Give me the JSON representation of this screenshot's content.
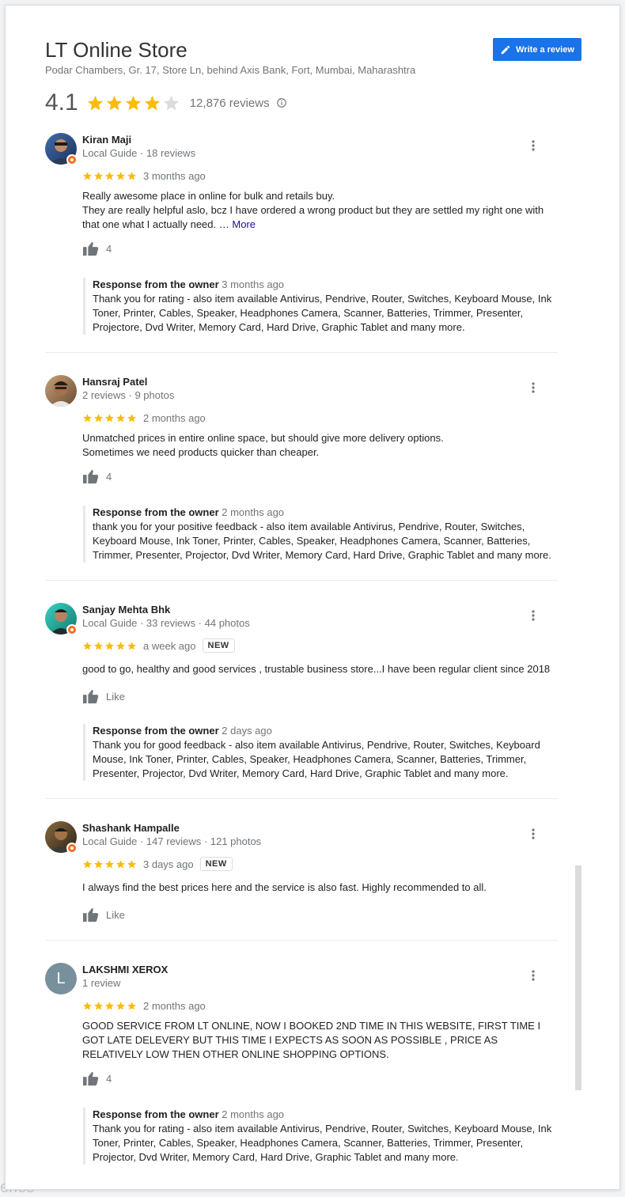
{
  "header": {
    "title": "LT Online Store",
    "address": "Podar Chambers, Gr. 17, Store Ln, behind Axis Bank, Fort, Mumbai, Maharashtra",
    "write_review_label": "Write a review",
    "rating": "4.1",
    "rating_value": 4.1,
    "review_count": "12,876 reviews"
  },
  "colors": {
    "accent": "#1a73e8",
    "star": "#fbbc04",
    "guide_badge": "#f16e23",
    "avatar_initial_bg": "#78909c"
  },
  "reviews": [
    {
      "name": "Kiran Maji",
      "meta": "Local Guide · 18 reviews",
      "stars": 5,
      "time": "3 months ago",
      "new_badge": "",
      "text": "Really awesome place in online for bulk and retails buy.\nThey are really helpful aslo, bcz I have ordered a wrong product but they are settled my right one with that one what I actually need. …",
      "more_label": "More",
      "likes": "4",
      "owner_label": "Response from the owner",
      "owner_time": "3 months ago",
      "owner_text": "Thank you for rating - also item available Antivirus, Pendrive, Router, Switches, Keyboard Mouse, Ink Toner, Printer, Cables, Speaker, Headphones Camera, Scanner, Batteries, Trimmer, Presenter, Projectore, Dvd Writer, Memory Card, Hard Drive, Graphic Tablet and many more."
    },
    {
      "name": "Hansraj Patel",
      "meta": "2 reviews · 9 photos",
      "stars": 5,
      "time": "2 months ago",
      "new_badge": "",
      "text": "Unmatched prices in entire online space, but should give more delivery options.\nSometimes we need products quicker than cheaper.",
      "likes": "4",
      "owner_label": "Response from the owner",
      "owner_time": "2 months ago",
      "owner_text": "thank you for your positive feedback - also item available Antivirus, Pendrive, Router, Switches, Keyboard Mouse, Ink Toner, Printer, Cables, Speaker, Headphones Camera, Scanner, Batteries, Trimmer, Presenter, Projector, Dvd Writer, Memory Card, Hard Drive, Graphic Tablet and many more."
    },
    {
      "name": "Sanjay Mehta Bhk",
      "meta": "Local Guide · 33 reviews · 44 photos",
      "stars": 5,
      "time": "a week ago",
      "new_badge": "NEW",
      "text": "good to go, healthy and good services , trustable business store...I have been regular client since 2018",
      "likes": "Like",
      "owner_label": "Response from the owner",
      "owner_time": "2 days ago",
      "owner_text": "Thank you for good feedback - also item available Antivirus, Pendrive, Router, Switches, Keyboard Mouse, Ink Toner, Printer, Cables, Speaker, Headphones Camera, Scanner, Batteries, Trimmer, Presenter, Projector, Dvd Writer, Memory Card, Hard Drive, Graphic Tablet and many more."
    },
    {
      "name": "Shashank Hampalle",
      "meta": "Local Guide · 147 reviews · 121 photos",
      "stars": 5,
      "time": "3 days ago",
      "new_badge": "NEW",
      "text": "I always find the best prices here and the service is also fast. Highly recommended to all.",
      "likes": "Like"
    },
    {
      "name": "LAKSHMI XEROX",
      "meta": "1 review",
      "avatar_initial": "L",
      "stars": 5,
      "time": "2 months ago",
      "new_badge": "",
      "text": "GOOD SERVICE FROM LT ONLINE, NOW I BOOKED 2ND TIME IN THIS WEBSITE, FIRST TIME I GOT LATE DELEVERY BUT THIS TIME I EXPECTS AS SOON AS POSSIBLE , PRICE AS RELATIVELY LOW THEN OTHER ONLINE SHOPPING OPTIONS.",
      "likes": "4",
      "owner_label": "Response from the owner",
      "owner_time": "2 months ago",
      "owner_text": "Thank you for rating - also item available Antivirus, Pendrive, Router, Switches, Keyboard Mouse, Ink Toner, Printer, Cables, Speaker, Headphones Camera, Scanner, Batteries, Trimmer, Presenter, Projector, Dvd Writer, Memory Card, Hard Drive, Graphic Tablet and many more."
    }
  ]
}
